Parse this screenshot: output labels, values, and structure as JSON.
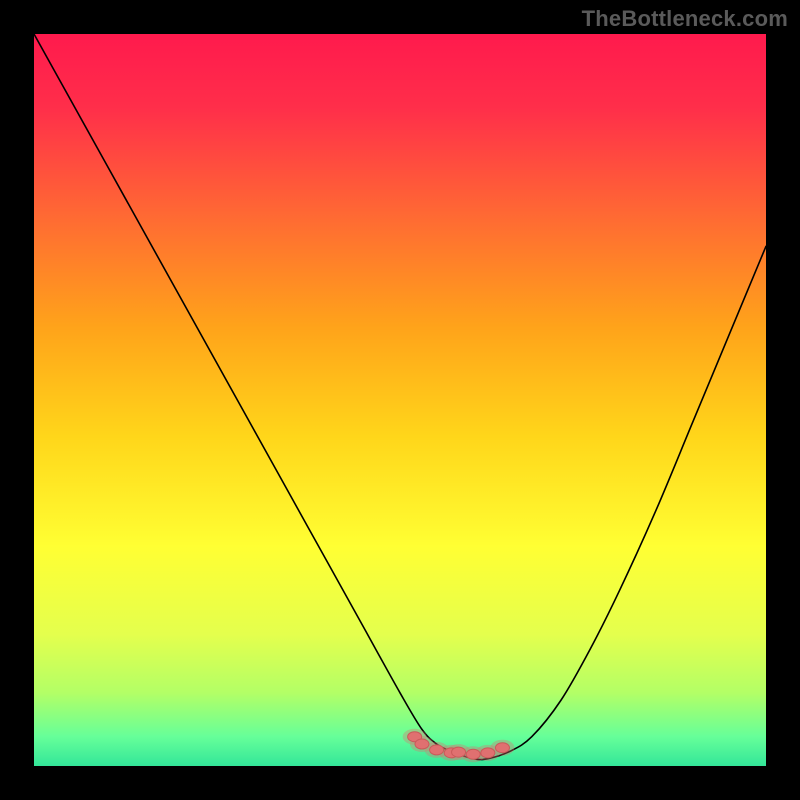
{
  "watermark": "TheBottleneck.com",
  "colors": {
    "gradient_stops": [
      {
        "offset": 0.0,
        "color": "#ff1a4d"
      },
      {
        "offset": 0.1,
        "color": "#ff2e4a"
      },
      {
        "offset": 0.25,
        "color": "#ff6a33"
      },
      {
        "offset": 0.4,
        "color": "#ffa31a"
      },
      {
        "offset": 0.55,
        "color": "#ffd61a"
      },
      {
        "offset": 0.7,
        "color": "#ffff33"
      },
      {
        "offset": 0.82,
        "color": "#e4ff4d"
      },
      {
        "offset": 0.9,
        "color": "#b3ff66"
      },
      {
        "offset": 0.96,
        "color": "#66ff99"
      },
      {
        "offset": 1.0,
        "color": "#33e699"
      }
    ],
    "curve": "#000000",
    "marker": "#e07070",
    "marker_stroke": "#c95a5a"
  },
  "chart_data": {
    "type": "line",
    "title": "",
    "xlabel": "",
    "ylabel": "",
    "xlim": [
      0,
      100
    ],
    "ylim": [
      0,
      100
    ],
    "grid": false,
    "legend": null,
    "series": [
      {
        "name": "curve",
        "x": [
          0,
          5,
          10,
          15,
          20,
          25,
          30,
          35,
          40,
          45,
          50,
          53,
          55,
          57,
          60,
          62,
          65,
          68,
          72,
          76,
          80,
          85,
          90,
          95,
          100
        ],
        "y": [
          100,
          91,
          82,
          73,
          64,
          55,
          46,
          37,
          28,
          19,
          10,
          5,
          3,
          2,
          1,
          1,
          2,
          4,
          9,
          16,
          24,
          35,
          47,
          59,
          71
        ]
      }
    ],
    "markers": {
      "name": "highlight-cluster",
      "x": [
        52,
        53,
        55,
        57,
        60,
        62,
        64,
        58
      ],
      "y": [
        4.0,
        3.0,
        2.2,
        1.8,
        1.6,
        1.8,
        2.5,
        1.9
      ]
    }
  }
}
